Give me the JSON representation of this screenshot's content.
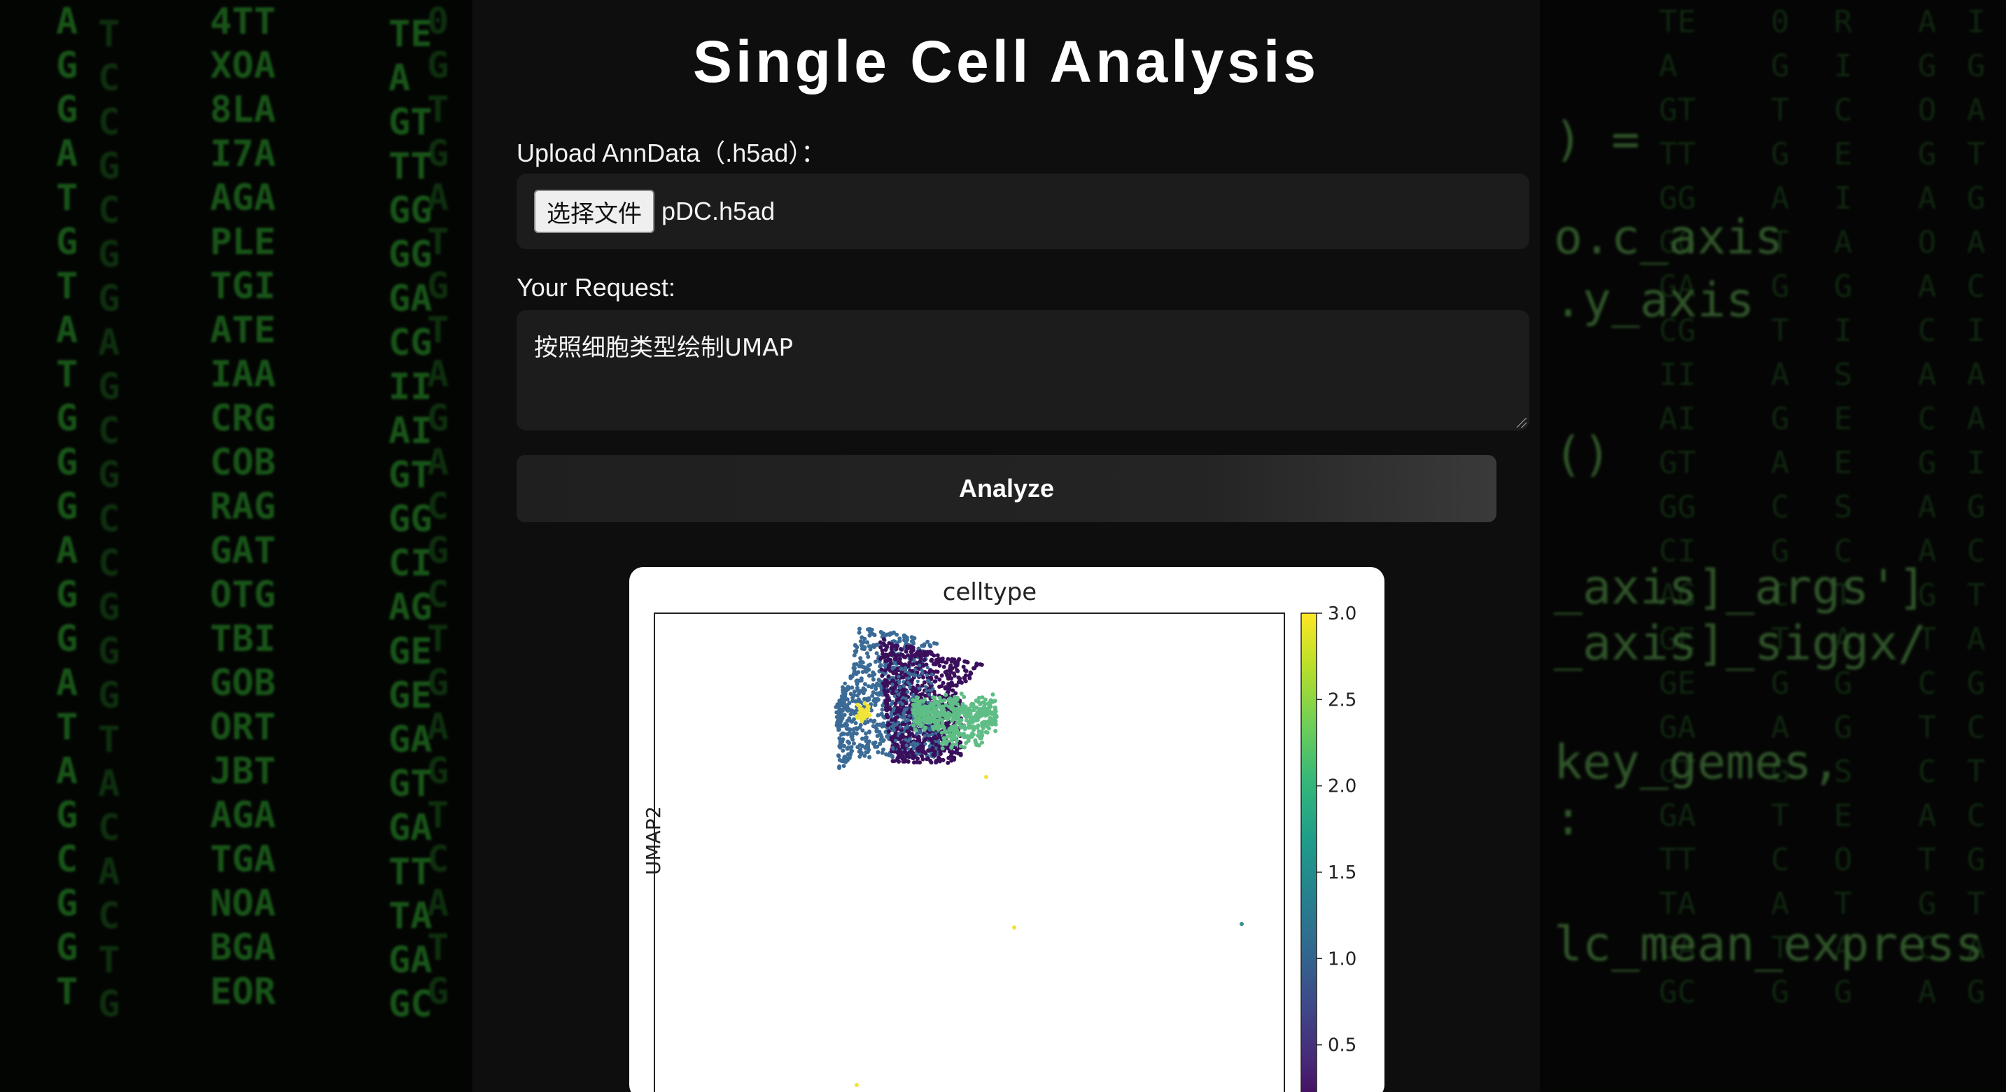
{
  "page": {
    "title": "Single Cell Analysis"
  },
  "upload": {
    "label": "Upload AnnData（.h5ad）：",
    "button_label": "选择文件",
    "file_name": "pDC.h5ad"
  },
  "request": {
    "label": "Your Request:",
    "value": "按照细胞类型绘制UMAP"
  },
  "analyze": {
    "label": "Analyze"
  },
  "background": {
    "matrix_columns": [
      "A\nG\nG\nA\nT\nG\nT\nA\nT\nG\nG\nG\nA\nG\nG\nA\nT\nA\nG\nC\nG\nG\nT",
      "T\nC\nC\nG\nC\nG\nG\nA\nG\nC\nG\nC\nC\nG\nG\nG\nT\nA\nC\nA\nC\nT\nG",
      "4TT\nXOA\n8LA\nI7A\nAGA\nPLE\nTGI\nATE\nIAA\nCRG\nCOB\nRAG\nGAT\nOTG\nTBI\nGOB\nORT\nJBT\nAGA\nTGA\nNOA\nBGA\nEOR",
      "TE\nA\nGT\nTT\nGG\nGG\nGA\nCG\nII\nAI\nGT\nGG\nCI\nAG\nGE\nGE\nGA\nGT\nGA\nTT\nTA\nGA\nGC",
      "0\nG\nT\nG\nA\nT\nG\nT\nA\nG\nA\nC\nG\nC\nT\nG\nA\nG\nT\nC\nA\nT\nG",
      "R\nI\nC\nE\nI\nA\nG\nI\nS\nE\nE\nS\nC\nT\nA\nG\nG\nS\nE\nO\nT\nA\nG",
      "A\nG\nO\nG\nA\nO\nA\nC\nA\nC\nG\nA\nA\nG\nT\nC\nT\nC\nA\nT\nG\nC\nA",
      "I\nG\nA\nT\nG\nA\nC\nI\nA\nA\nI\nG\nC\nT\nA\nG\nC\nT\nC\nG\nT\nA\nG"
    ],
    "code_lines": [
      ") =",
      "o.c_axis",
      ".y_axis",
      "()",
      "_axis]_args']",
      "_axis]_siggx/",
      "key_gemes,",
      ":",
      "lc_mean_express"
    ]
  },
  "plot": {
    "title": "celltype",
    "ylabel": "UMAP2",
    "colorbar_ticks": [
      "3.0",
      "2.5",
      "2.0",
      "1.5",
      "1.0",
      "0.5"
    ]
  },
  "chart_data": {
    "type": "scatter",
    "title": "celltype",
    "xlabel": "",
    "ylabel": "UMAP2",
    "color_label": "celltype",
    "colormap": "viridis",
    "color_range": [
      0.0,
      3.0
    ],
    "colorbar_ticks": [
      0.5,
      1.0,
      1.5,
      2.0,
      2.5,
      3.0
    ],
    "grid": false,
    "ticks_visible": false,
    "clusters": [
      {
        "celltype": 1,
        "color": "#3b6b96",
        "description": "large left lobe of main cluster"
      },
      {
        "celltype": 0,
        "color": "#3a0f5c",
        "description": "large right lobe of main cluster"
      },
      {
        "celltype": 2,
        "color": "#5fbd86",
        "description": "elongated cluster to the right"
      },
      {
        "celltype": 1,
        "color": "#3b6b96",
        "description": "small elongated cluster below"
      },
      {
        "celltype": 3,
        "color": "#f0e43a",
        "description": "small bright cluster below"
      }
    ],
    "outlier_points": [
      {
        "celltype": 3,
        "color": "#f0e43a"
      },
      {
        "celltype": 3,
        "color": "#f0e43a"
      },
      {
        "celltype": 3,
        "color": "#f0e43a"
      },
      {
        "celltype": 1,
        "color": "#3b8f8c"
      }
    ]
  }
}
